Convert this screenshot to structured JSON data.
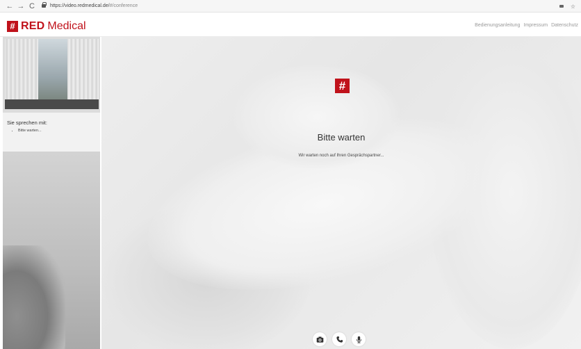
{
  "browser": {
    "back_glyph": "←",
    "forward_glyph": "→",
    "reload_glyph": "C",
    "url_host": "https://video.redmedical.de/",
    "url_path": "#/conference",
    "star_glyph": "☆",
    "icons": [
      "lock-icon",
      "camera-indicator-icon",
      "star-icon"
    ]
  },
  "header": {
    "logo_symbol": "#",
    "logo_red": "RED",
    "logo_medical": "Medical",
    "links": [
      "Bedienungsanleitung",
      "Impressum",
      "Datenschutz"
    ]
  },
  "sidebar": {
    "talking_title": "Sie sprechen mit:",
    "participants": [
      "Bitte warten..."
    ]
  },
  "main": {
    "logo_symbol": "#",
    "wait_title": "Bitte warten",
    "wait_message": "Wir warten noch auf Ihren Gesprächspartner..."
  },
  "controls": {
    "icons": [
      "camera-icon",
      "phone-icon",
      "microphone-icon"
    ]
  },
  "colors": {
    "brand": "#c0121b",
    "link": "#9a9a9a"
  }
}
